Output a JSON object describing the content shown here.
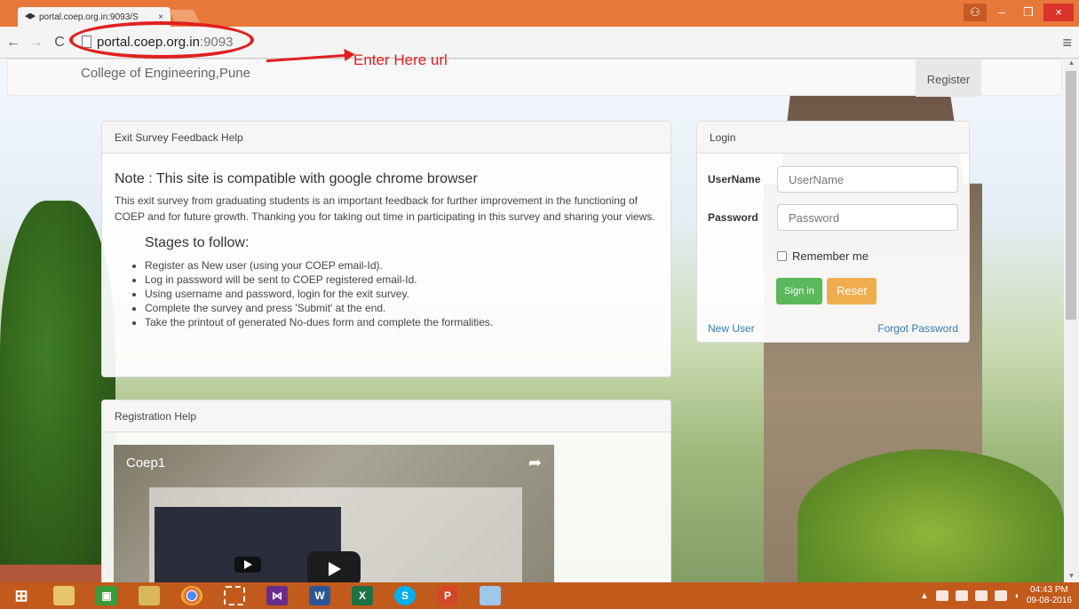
{
  "browser": {
    "tab_title": "portal.coep.org.in:9093/S",
    "tab_close": "×",
    "back": "←",
    "forward": "→",
    "reload": "C",
    "url_host": "portal.coep.org.in",
    "url_port": ":9093",
    "menu": "≡",
    "window_controls": {
      "minimize": "‒",
      "maximize": "❐",
      "close": "×"
    }
  },
  "annotation": {
    "text": "Enter Here url",
    "color": "#e02020"
  },
  "navbar": {
    "brand": "College of Engineering,Pune",
    "register": "Register"
  },
  "help_panel": {
    "heading": "Exit Survey Feedback Help",
    "note": "Note : This site is compatible with google chrome browser",
    "description": "This exit survey from graduating students is an important feedback for further improvement in the functioning of COEP and for future growth. Thanking you for taking out time in participating in this survey and sharing your views.",
    "stages_title": "Stages to follow:",
    "steps": [
      "Register as New user (using your COEP email-Id).",
      "Log in password will be sent to COEP registered email-Id.",
      "Using username and password, login for the exit survey.",
      "Complete the survey and press 'Submit' at the end.",
      "Take the printout of generated No-dues form and complete the formalities."
    ]
  },
  "registration_panel": {
    "heading": "Registration Help",
    "video_title": "Coep1"
  },
  "login": {
    "heading": "Login",
    "username_label": "UserName",
    "username_placeholder": "UserName",
    "password_label": "Password",
    "password_placeholder": "Password",
    "remember": "Remember me",
    "sign_in": "Sign in",
    "reset": "Reset",
    "new_user": "New User",
    "forgot": "Forgot Password"
  },
  "taskbar": {
    "apps": [
      "start",
      "file-explorer",
      "store",
      "folder",
      "chrome",
      "snipping-tool",
      "visual-studio",
      "word",
      "excel",
      "skype",
      "powerpoint",
      "paint"
    ],
    "time": "04:43 PM",
    "date": "09-08-2016"
  },
  "colors": {
    "titlebar": "#e8783a",
    "taskbar": "#c25a1c",
    "signin": "#5cb85c",
    "reset": "#f0ad4e",
    "link": "#337ab7"
  }
}
